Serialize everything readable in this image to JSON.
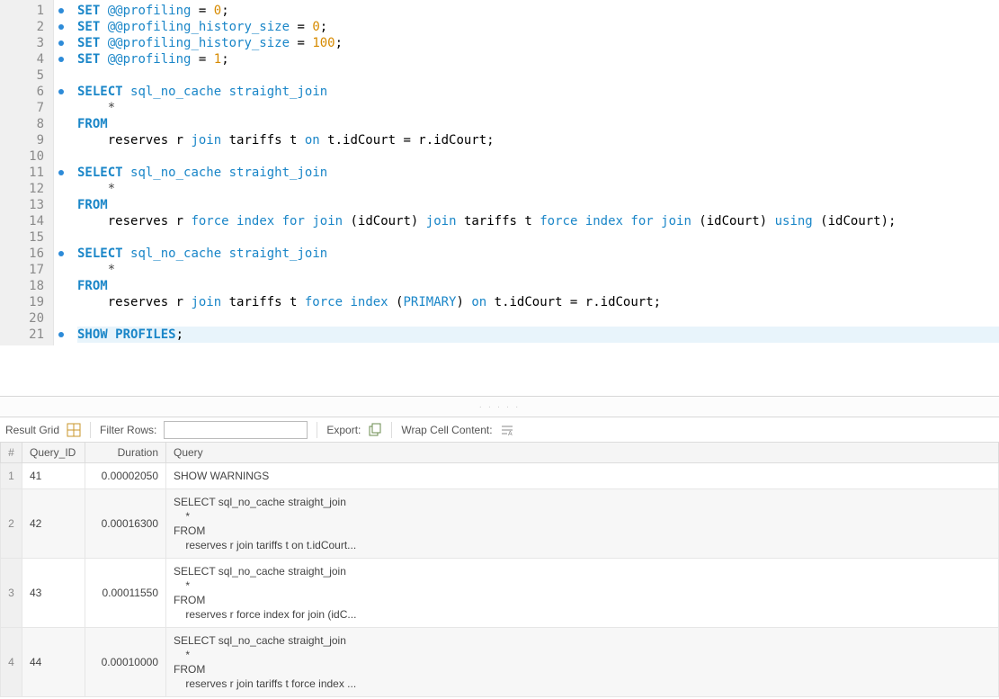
{
  "editor": {
    "lines": [
      {
        "n": 1,
        "dot": true,
        "html": "<span class='kw'>SET</span> <span class='sysvar'>@@profiling</span> = <span class='num'>0</span>;"
      },
      {
        "n": 2,
        "dot": true,
        "html": "<span class='kw'>SET</span> <span class='sysvar'>@@profiling_history_size</span> = <span class='num'>0</span>;"
      },
      {
        "n": 3,
        "dot": true,
        "html": "<span class='kw'>SET</span> <span class='sysvar'>@@profiling_history_size</span> = <span class='num'>100</span>;"
      },
      {
        "n": 4,
        "dot": true,
        "html": "<span class='kw'>SET</span> <span class='sysvar'>@@profiling</span> = <span class='num'>1</span>;"
      },
      {
        "n": 5,
        "dot": false,
        "html": ""
      },
      {
        "n": 6,
        "dot": true,
        "html": "<span class='kw'>SELECT</span> <span class='kw2'>sql_no_cache</span> <span class='kw2'>straight_join</span>"
      },
      {
        "n": 7,
        "dot": false,
        "html": "    <span class='op'>*</span>"
      },
      {
        "n": 8,
        "dot": false,
        "html": "<span class='kw'>FROM</span>"
      },
      {
        "n": 9,
        "dot": false,
        "html": "    reserves r <span class='kw2'>join</span> tariffs t <span class='kw2'>on</span> t.idCourt = r.idCourt;"
      },
      {
        "n": 10,
        "dot": false,
        "html": ""
      },
      {
        "n": 11,
        "dot": true,
        "html": "<span class='kw'>SELECT</span> <span class='kw2'>sql_no_cache</span> <span class='kw2'>straight_join</span>"
      },
      {
        "n": 12,
        "dot": false,
        "html": "    <span class='op'>*</span>"
      },
      {
        "n": 13,
        "dot": false,
        "html": "<span class='kw'>FROM</span>"
      },
      {
        "n": 14,
        "dot": false,
        "html": "    reserves r <span class='kw2'>force</span> <span class='kw2'>index</span> <span class='kw2'>for</span> <span class='kw2'>join</span> (idCourt) <span class='kw2'>join</span> tariffs t <span class='kw2'>force</span> <span class='kw2'>index</span> <span class='kw2'>for</span> <span class='kw2'>join</span> (idCourt) <span class='kw2'>using</span> (idCourt);"
      },
      {
        "n": 15,
        "dot": false,
        "html": ""
      },
      {
        "n": 16,
        "dot": true,
        "html": "<span class='kw'>SELECT</span> <span class='kw2'>sql_no_cache</span> <span class='kw2'>straight_join</span>"
      },
      {
        "n": 17,
        "dot": false,
        "html": "    <span class='op'>*</span>"
      },
      {
        "n": 18,
        "dot": false,
        "html": "<span class='kw'>FROM</span>"
      },
      {
        "n": 19,
        "dot": false,
        "html": "    reserves r <span class='kw2'>join</span> tariffs t <span class='kw2'>force</span> <span class='kw2'>index</span> (<span class='kw2'>PRIMARY</span>) <span class='kw2'>on</span> t.idCourt = r.idCourt;"
      },
      {
        "n": 20,
        "dot": false,
        "html": ""
      },
      {
        "n": 21,
        "dot": true,
        "hl": true,
        "html": "<span class='kw'>SHOW</span> <span class='kw'>PROFILES</span>;"
      }
    ]
  },
  "toolbar": {
    "result_grid_label": "Result Grid",
    "filter_rows_label": "Filter Rows:",
    "filter_placeholder": "",
    "export_label": "Export:",
    "wrap_label": "Wrap Cell Content:"
  },
  "grid": {
    "headers": {
      "rownum": "#",
      "query_id": "Query_ID",
      "duration": "Duration",
      "query": "Query"
    },
    "rows": [
      {
        "row": "1",
        "query_id": "41",
        "duration": "0.00002050",
        "query": "SHOW WARNINGS"
      },
      {
        "row": "2",
        "query_id": "42",
        "duration": "0.00016300",
        "query": "SELECT sql_no_cache straight_join\n    *\nFROM\n    reserves r join tariffs t on t.idCourt..."
      },
      {
        "row": "3",
        "query_id": "43",
        "duration": "0.00011550",
        "query": "SELECT sql_no_cache straight_join\n    *\nFROM\n    reserves r force index for join (idC..."
      },
      {
        "row": "4",
        "query_id": "44",
        "duration": "0.00010000",
        "query": "SELECT sql_no_cache straight_join\n    *\nFROM\n    reserves r join tariffs t force index ..."
      }
    ]
  }
}
